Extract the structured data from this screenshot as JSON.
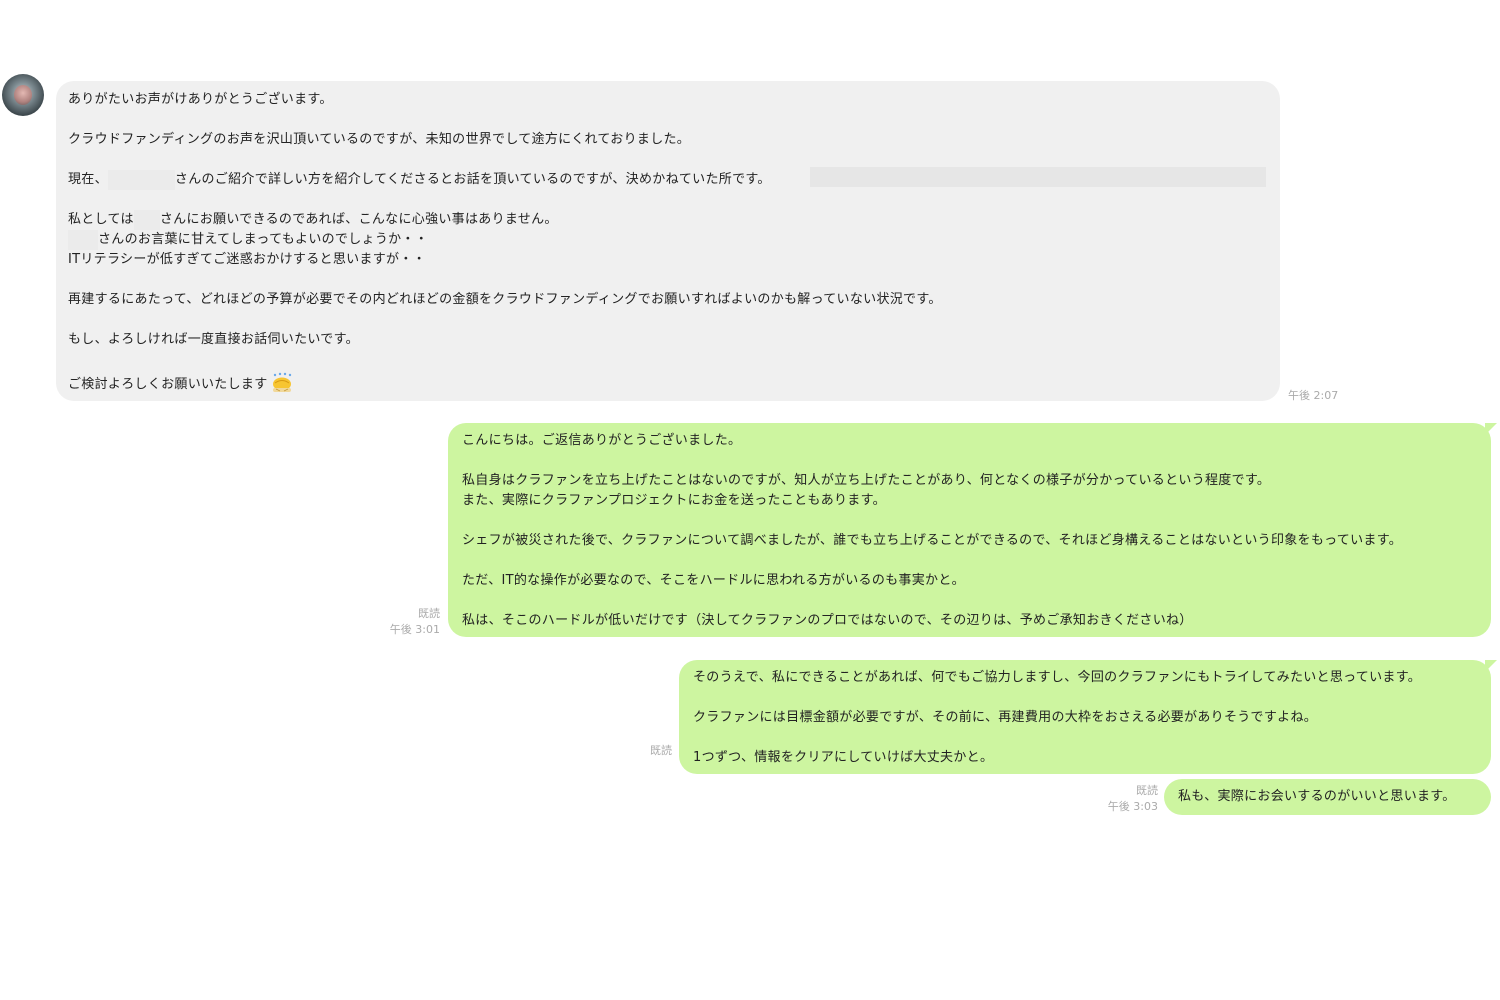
{
  "incoming": {
    "time": "午後 2:07",
    "lines": [
      "ありがたいお声がけありがとうございます。",
      "",
      "クラウドファンディングのお声を沢山頂いているのですが、未知の世界でして途方にくれておりました。",
      "",
      {
        "before": "現在、",
        "after": "さんのご紹介で詳しい方を紹介してくださるとお話を頂いているのですが、決めかねていた所です。"
      },
      "",
      {
        "before": "私としては",
        "after": "さんにお願いできるのであれば、こんなに心強い事はありません。"
      },
      {
        "before": "",
        "after": "さんのお言葉に甘えてしまってもよいのでしょうか・・"
      },
      "ITリテラシーが低すぎてご迷惑おかけすると思いますが・・",
      "",
      "再建するにあたって、どれほどの予算が必要でその内どれほどの金額をクラウドファンディングでお願いすればよいのかも解っていない状況です。",
      "",
      "もし、よろしければ一度直接お話伺いたいです。",
      "",
      "ご検討よろしくお願いいたします"
    ],
    "emoji": "bowing-person-emoji"
  },
  "outgoing": [
    {
      "read": "既読",
      "time": "午後 3:01",
      "lines": [
        "こんにちは。ご返信ありがとうございました。",
        "",
        "私自身はクラファンを立ち上げたことはないのですが、知人が立ち上げたことがあり、何となくの様子が分かっているという程度です。",
        "また、実際にクラファンプロジェクトにお金を送ったこともあります。",
        "",
        "シェフが被災された後で、クラファンについて調べましたが、誰でも立ち上げることができるので、それほど身構えることはないという印象をもっています。",
        "",
        "ただ、IT的な操作が必要なので、そこをハードルに思われる方がいるのも事実かと。",
        "",
        "私は、そこのハードルが低いだけです（決してクラファンのプロではないので、その辺りは、予めご承知おきくださいね）"
      ]
    },
    {
      "read": "既読",
      "time": "",
      "lines": [
        "そのうえで、私にできることがあれば、何でもご協力しますし、今回のクラファンにもトライしてみたいと思っています。",
        "",
        "クラファンには目標金額が必要ですが、その前に、再建費用の大枠をおさえる必要がありそうですよね。",
        "",
        "1つずつ、情報をクリアにしていけば大丈夫かと。"
      ]
    },
    {
      "read": "既読",
      "time": "午後 3:03",
      "lines": [
        "私も、実際にお会いするのがいいと思います。"
      ]
    }
  ],
  "colors": {
    "incoming_bubble": "#f0f0f0",
    "outgoing_bubble": "#cdf5a0",
    "meta_text": "#aaaaaa"
  }
}
